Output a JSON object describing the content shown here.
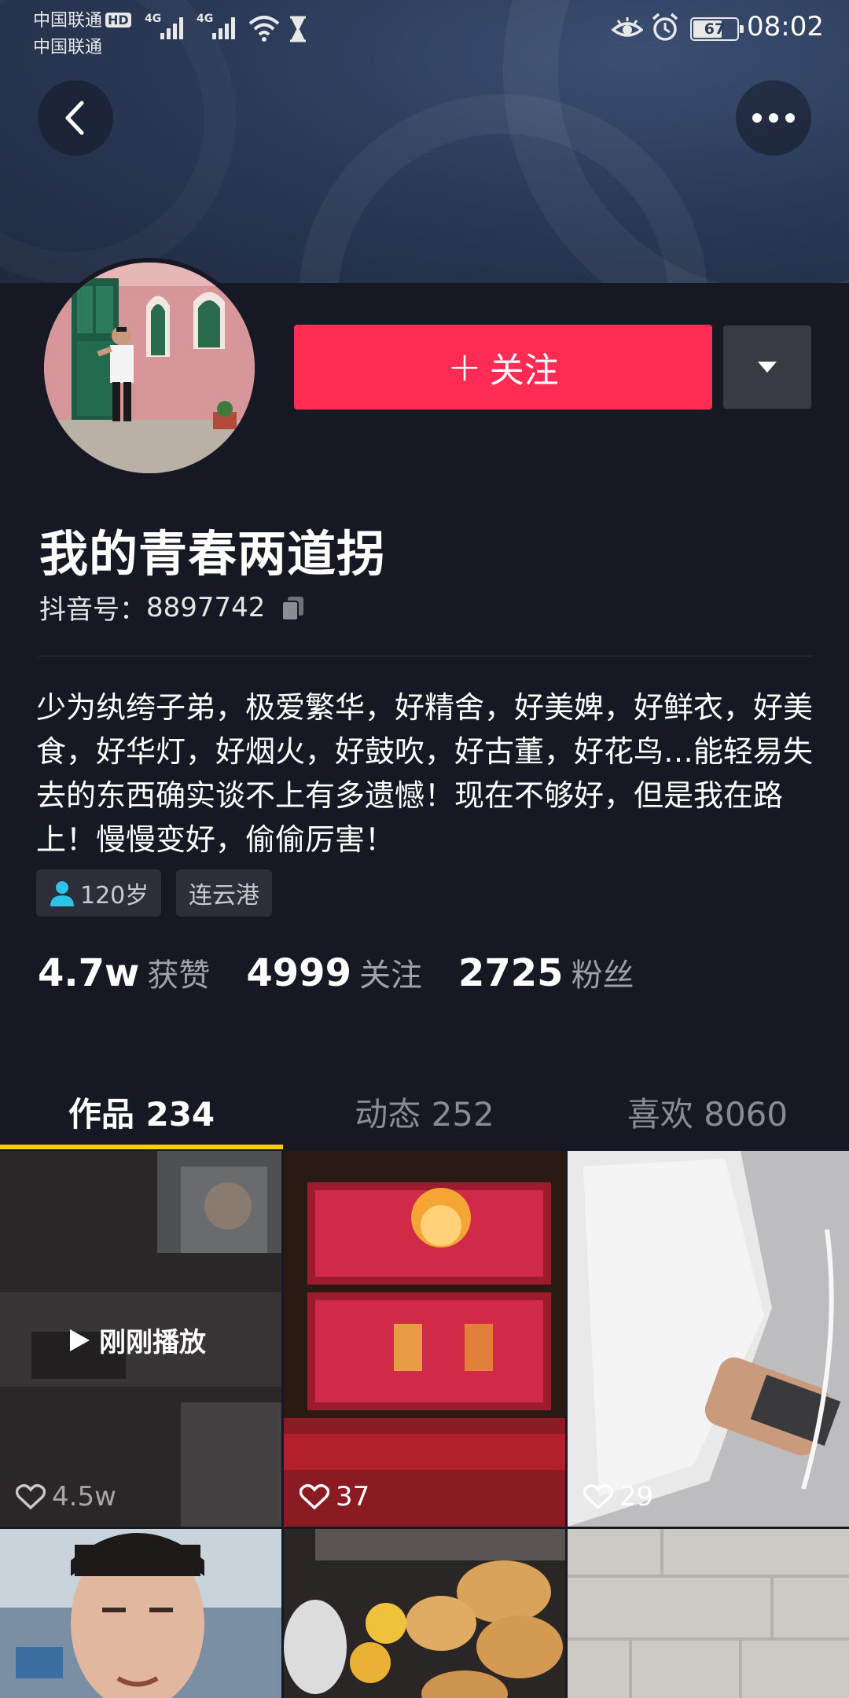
{
  "status_bar": {
    "carrier_1": "中国联通",
    "hd_badge": "HD",
    "carrier_2": "中国联通",
    "network_1": "4G",
    "network_2": "4G",
    "battery_level": 67,
    "battery_text": "67",
    "time": "08:02"
  },
  "header": {
    "back_icon": "chevron-left-icon",
    "more_icon": "more-horizontal-icon"
  },
  "profile": {
    "follow_label": "关注",
    "nickname": "我的青春两道拐",
    "account_label": "抖音号：",
    "account_id": "8897742",
    "bio": "少为纨绔子弟，极爱繁华，好精舍，好美婢，好鲜衣，好美食，好华灯，好烟火，好鼓吹，好古董，好花鸟…能轻易失去的东西确实谈不上有多遗憾！现在不够好，但是我在路上！慢慢变好，偷偷厉害！",
    "tags": {
      "age": "120岁",
      "city": "连云港"
    },
    "stats": [
      {
        "value": "4.7w",
        "label": "获赞"
      },
      {
        "value": "4999",
        "label": "关注"
      },
      {
        "value": "2725",
        "label": "粉丝"
      }
    ]
  },
  "tabs": [
    {
      "label": "作品 234",
      "active": true
    },
    {
      "label": "动态 252",
      "active": false
    },
    {
      "label": "喜欢 8060",
      "active": false
    }
  ],
  "videos": [
    {
      "likes": "4.5w",
      "overlay": "刚刚播放"
    },
    {
      "likes": "37"
    },
    {
      "likes": "29"
    }
  ],
  "colors": {
    "background": "#161823",
    "follow_button": "#fe2c55",
    "tab_indicator": "#facd01",
    "tag_bg": "#2c2f3a",
    "person_icon": "#2ec4e8"
  }
}
